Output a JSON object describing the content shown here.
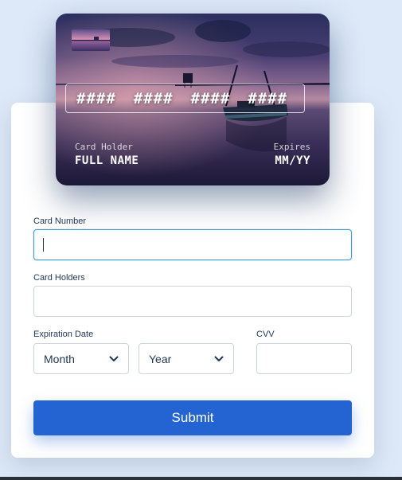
{
  "card_preview": {
    "number_groups": [
      "####",
      "####",
      "####",
      "####"
    ],
    "holder_label": "Card Holder",
    "holder_value": "FULL NAME",
    "expires_label": "Expires",
    "expires_value": "MM/YY"
  },
  "form": {
    "card_number": {
      "label": "Card Number",
      "value": "",
      "placeholder": ""
    },
    "card_holders": {
      "label": "Card Holders",
      "value": "",
      "placeholder": ""
    },
    "expiration": {
      "label": "Expiration Date",
      "month_selected": "Month",
      "year_selected": "Year"
    },
    "cvv": {
      "label": "CVV",
      "value": ""
    },
    "submit_label": "Submit"
  },
  "colors": {
    "page_background": "#dde9f8",
    "accent": "#2364d2",
    "focus_border": "#3d9cd8",
    "text": "#1f3653"
  }
}
